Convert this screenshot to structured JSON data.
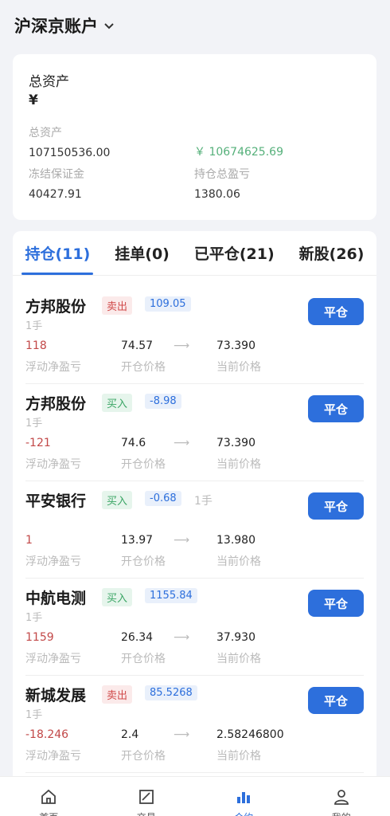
{
  "header": {
    "title": "沪深京账户"
  },
  "summary": {
    "label": "总资产",
    "currency": "¥",
    "items": [
      {
        "key": "总资产",
        "value": "107150536.00"
      },
      {
        "key": "",
        "value": "￥ 10674625.69"
      },
      {
        "key": "冻结保证金",
        "value": "40427.91"
      },
      {
        "key": "持仓总盈亏",
        "value": "1380.06"
      }
    ]
  },
  "tabs": [
    {
      "label": "持仓(11)"
    },
    {
      "label": "挂单(0)"
    },
    {
      "label": "已平仓(21)"
    },
    {
      "label": "新股(26)"
    }
  ],
  "labels": {
    "pl": "浮动净盈亏",
    "open": "开仓价格",
    "current": "当前价格",
    "close_button": "平仓",
    "arrow": "⟶"
  },
  "positions": [
    {
      "name": "方邦股份",
      "direction": "卖出",
      "pl_tag": "109.05",
      "lots": "1手",
      "pl": "118",
      "open": "74.57",
      "current": "73.390"
    },
    {
      "name": "方邦股份",
      "direction": "买入",
      "pl_tag": "-8.98",
      "lots": "1手",
      "pl": "-121",
      "open": "74.6",
      "current": "73.390"
    },
    {
      "name": "平安银行",
      "direction": "买入",
      "pl_tag": "-0.68",
      "lots": "1手",
      "pl": "1",
      "open": "13.97",
      "current": "13.980"
    },
    {
      "name": "中航电测",
      "direction": "买入",
      "pl_tag": "1155.84",
      "lots": "1手",
      "pl": "1159",
      "open": "26.34",
      "current": "37.930"
    },
    {
      "name": "新城发展",
      "direction": "卖出",
      "pl_tag": "85.5268",
      "lots": "1手",
      "pl": "-18.246",
      "open": "2.4",
      "current": "2.58246800"
    }
  ],
  "nav": [
    {
      "label": "首页",
      "icon": "home-icon"
    },
    {
      "label": "交易",
      "icon": "trade-icon"
    },
    {
      "label": "合约",
      "icon": "bar-chart-icon"
    },
    {
      "label": "我的",
      "icon": "user-icon"
    }
  ],
  "colors": {
    "accent": "#2d6fdc",
    "sell": "#d04a4a",
    "buy": "#3aa564",
    "loss": "#c24848"
  }
}
